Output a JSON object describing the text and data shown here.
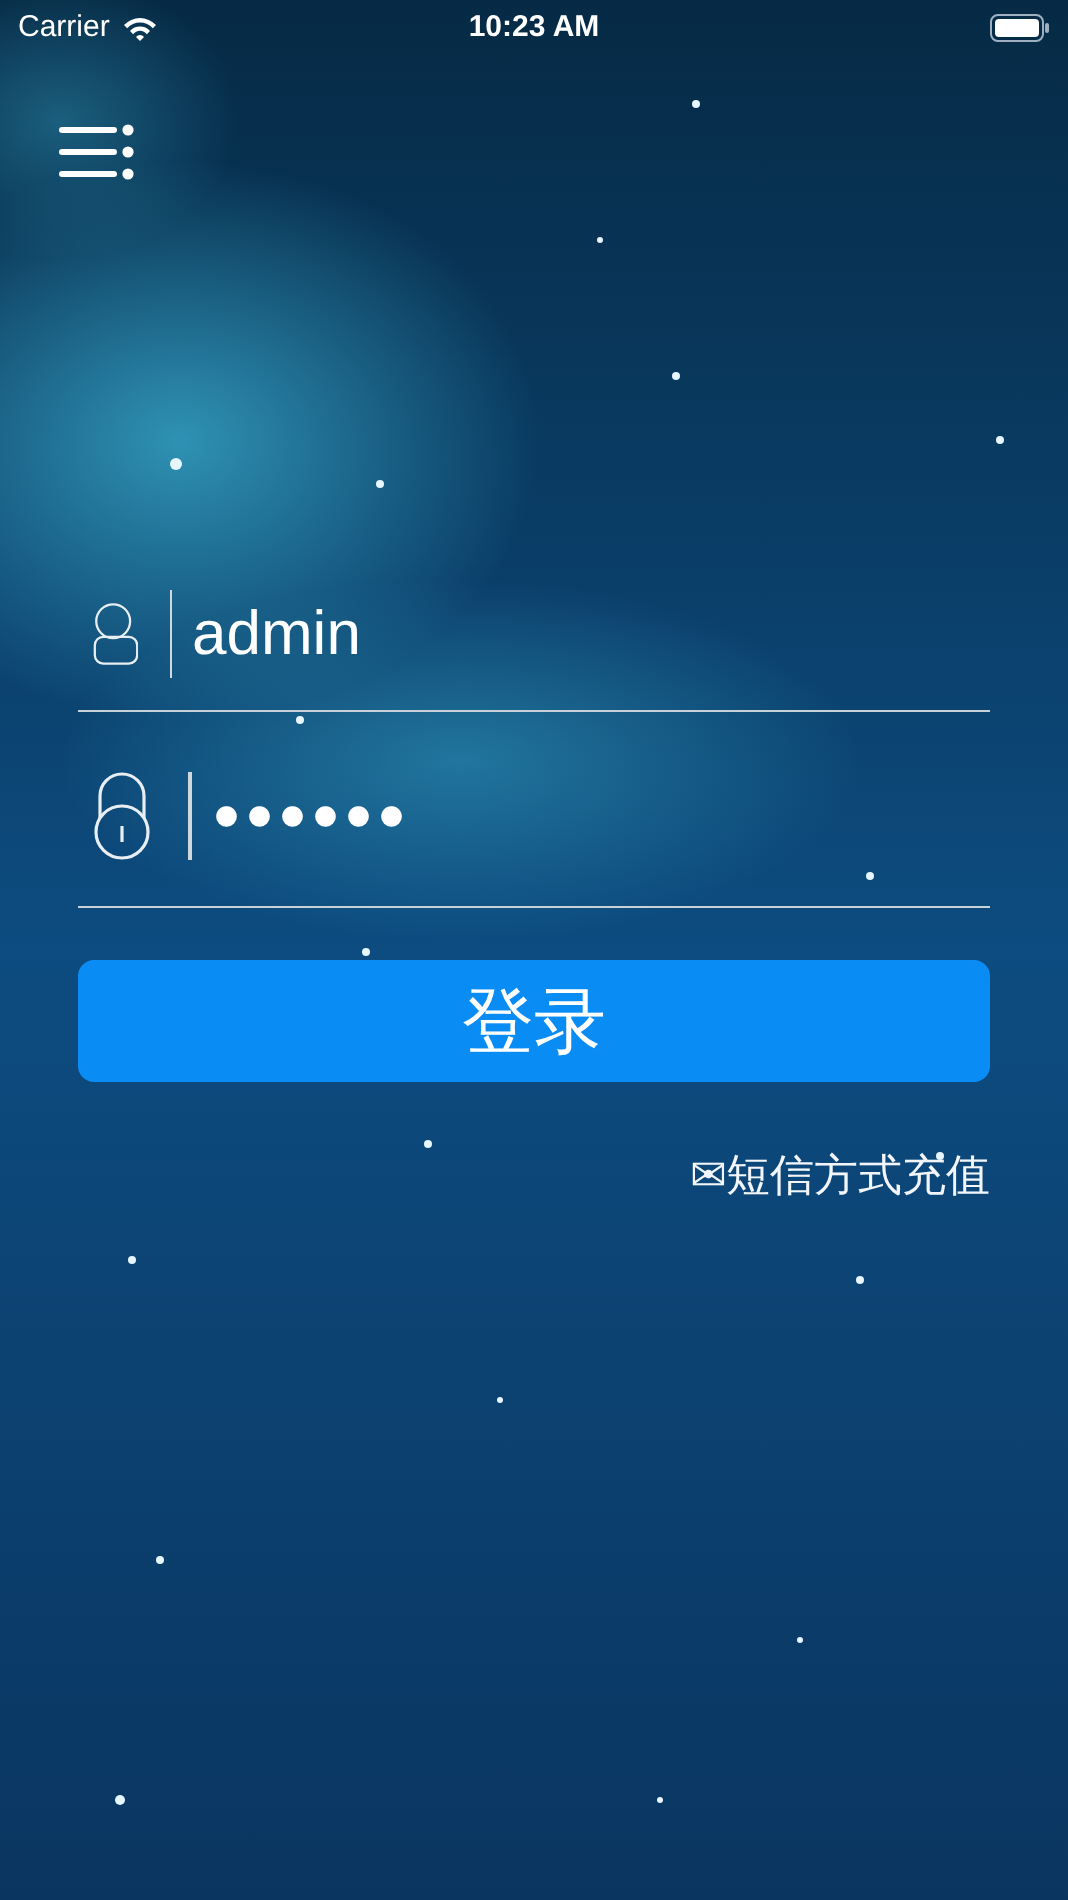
{
  "status_bar": {
    "carrier": "Carrier",
    "time": "10:23 AM"
  },
  "login": {
    "username": {
      "value": "admin"
    },
    "password": {
      "value": "●●●●●●"
    },
    "submit": "登录",
    "sms_link": "✉短信方式充值"
  }
}
